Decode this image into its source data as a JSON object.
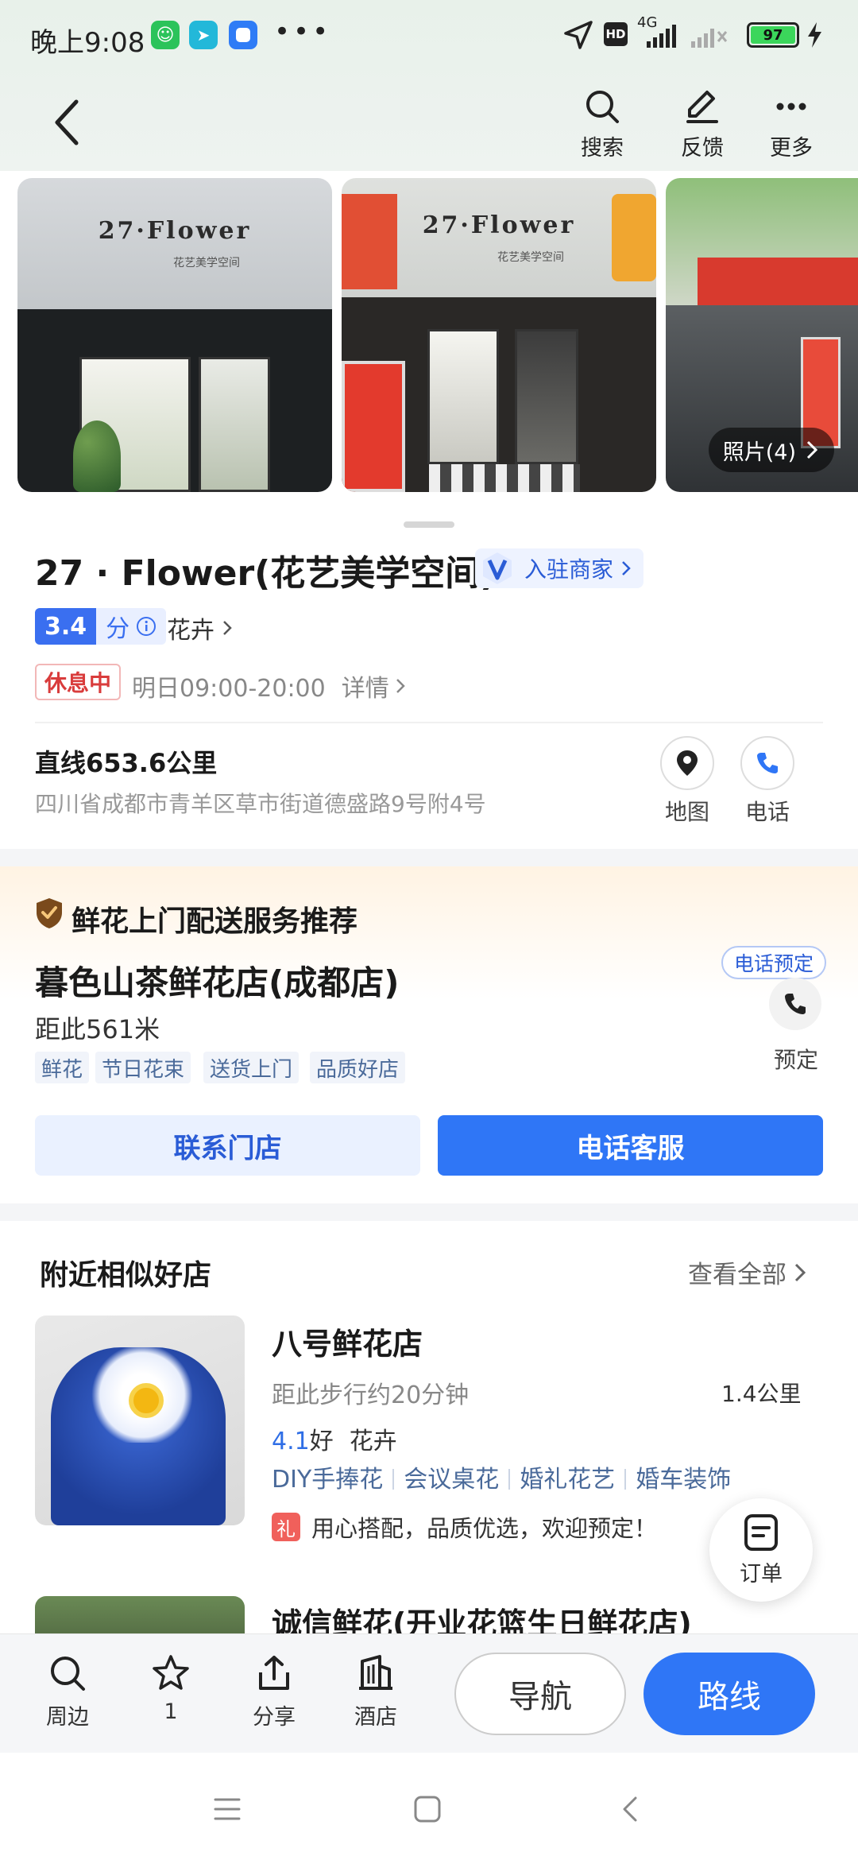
{
  "status": {
    "time": "晚上9:08",
    "dots": "•••",
    "network": "4G",
    "hd": "HD",
    "battery": "97"
  },
  "header": {
    "search": "搜索",
    "feedback": "反馈",
    "more": "更多"
  },
  "photos": {
    "count_label": "照片(4)",
    "sign_text": "27·Flower",
    "sign_sub": "花艺美学空间"
  },
  "place": {
    "title": "27 · Flower(花艺美学空间)",
    "merchant_badge": "入驻商家",
    "score": "3.4",
    "score_unit": "分",
    "category": "花卉",
    "status": "休息中",
    "hours": "明日09:00-20:00",
    "hours_detail": "详情",
    "distance": "直线653.6公里",
    "address": "四川省成都市青羊区草市街道德盛路9号附4号",
    "map_label": "地图",
    "phone_label": "电话"
  },
  "recommend": {
    "section_title": "鲜花上门配送服务推荐",
    "shop_name": "暮色山茶鲜花店(成都店)",
    "distance": "距此561米",
    "tags": [
      "鲜花",
      "节日花束",
      "送货上门",
      "品质好店"
    ],
    "phone_reserve": "电话预定",
    "reserve_label": "预定",
    "contact_btn": "联系门店",
    "service_btn": "电话客服"
  },
  "nearby": {
    "section_title": "附近相似好店",
    "see_all": "查看全部",
    "items": [
      {
        "name": "八号鲜花店",
        "walk": "距此步行约20分钟",
        "km": "1.4公里",
        "rating": "4.1",
        "rating_word": "好",
        "category": "花卉",
        "tags": [
          "DIY手捧花",
          "会议桌花",
          "婚礼花艺",
          "婚车装饰"
        ],
        "promo_badge": "礼",
        "promo": "用心搭配，品质优选，欢迎预定！"
      },
      {
        "name": "诚信鲜花(开业花篮生日鲜花店)"
      }
    ]
  },
  "float_order": "订单",
  "bottom": {
    "nearby": "周边",
    "fav": "1",
    "share": "分享",
    "hotel": "酒店",
    "navigate": "导航",
    "route": "路线"
  }
}
